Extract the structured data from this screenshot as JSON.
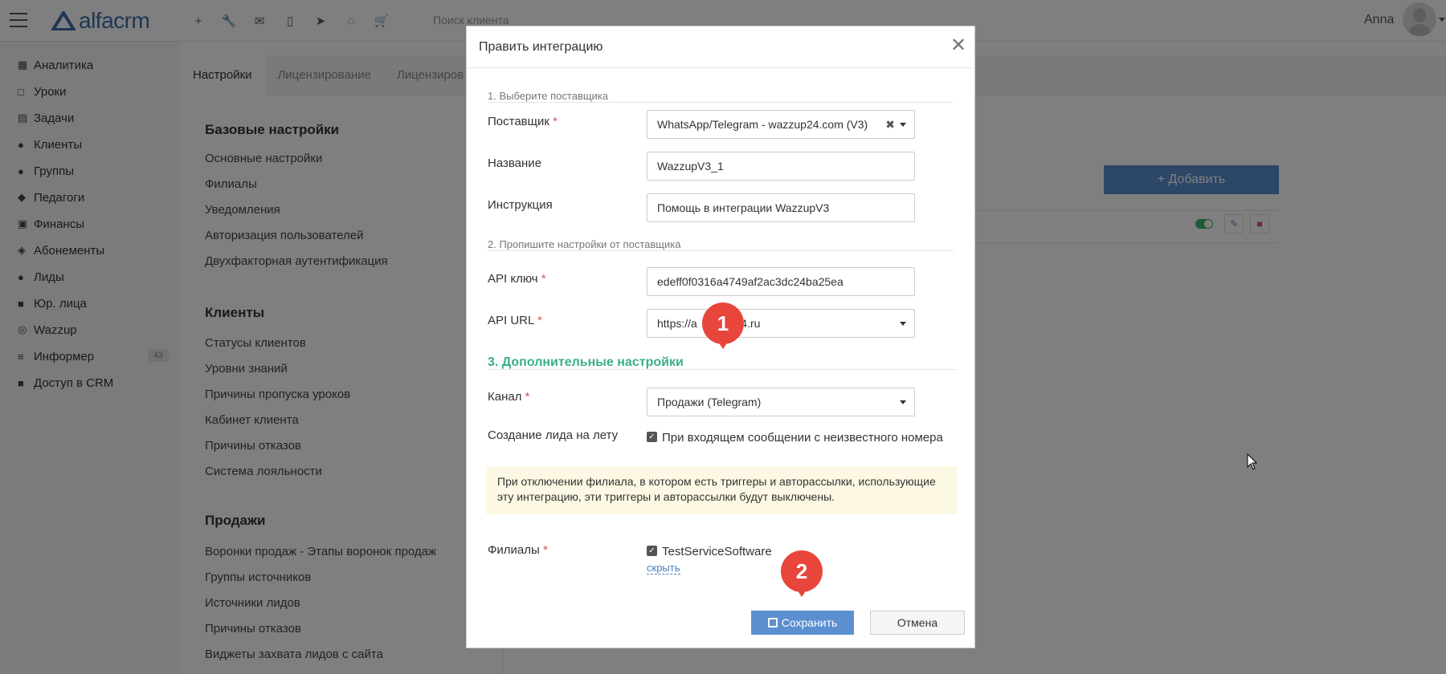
{
  "app": {
    "brand": "alfacrm",
    "search_placeholder": "Поиск клиента",
    "user_name": "Anna"
  },
  "sidebar": {
    "items": [
      {
        "label": "Аналитика",
        "icon": "map-icon"
      },
      {
        "label": "Уроки",
        "icon": "calendar-icon"
      },
      {
        "label": "Задачи",
        "icon": "clipboard-icon"
      },
      {
        "label": "Клиенты",
        "icon": "user-icon"
      },
      {
        "label": "Группы",
        "icon": "users-icon"
      },
      {
        "label": "Педагоги",
        "icon": "graduation-cap-icon"
      },
      {
        "label": "Финансы",
        "icon": "money-icon"
      },
      {
        "label": "Абонементы",
        "icon": "tag-icon"
      },
      {
        "label": "Лиды",
        "icon": "user-plus-icon"
      },
      {
        "label": "Юр. лица",
        "icon": "briefcase-icon"
      },
      {
        "label": "Wazzup",
        "icon": "whatsapp-icon"
      },
      {
        "label": "Информер",
        "icon": "database-icon",
        "badge": "43"
      },
      {
        "label": "Доступ в CRM",
        "icon": "lock-icon"
      }
    ]
  },
  "tabs": [
    "Настройки",
    "Лицензирование",
    "Лицензиров"
  ],
  "settings": {
    "base_title": "Базовые настройки",
    "base_links": [
      "Основные настройки",
      "Филиалы",
      "Уведомления",
      "Авторизация пользователей",
      "Двухфакторная аутентификация"
    ],
    "clients_title": "Клиенты",
    "clients_links": [
      "Статусы клиентов",
      "Уровни знаний",
      "Причины пропуска уроков",
      "Кабинет клиента",
      "Причины отказов",
      "Система лояльности"
    ],
    "sales_title": "Продажи",
    "sales_links": [
      "Воронки продаж - Этапы воронок продаж",
      "Группы источников",
      "Источники лидов",
      "Причины отказов",
      "Виджеты захвата лидов с сайта"
    ]
  },
  "add_button": "Добавить",
  "modal": {
    "title": "Править интеграцию",
    "section1": "1. Выберите поставщика",
    "provider_label": "Поставщик",
    "provider_value": "WhatsApp/Telegram - wazzup24.com (V3)",
    "name_label": "Название",
    "name_value": "WazzupV3_1",
    "instruction_label": "Инструкция",
    "instruction_value": "Помощь в интеграции WazzupV3",
    "section2": "2. Пропишите настройки от поставщика",
    "api_key_label": "API ключ",
    "api_key_value": "edeff0f0316a4749af2ac3dc24ba25ea",
    "api_url_label": "API URL",
    "api_url_value": "https://a          p24.ru",
    "section3": "3. Дополнительные настройки",
    "channel_label": "Канал",
    "channel_value": "Продажи (Telegram)",
    "lead_label": "Создание лида на лету",
    "lead_checkbox": "При входящем сообщении с неизвестного номера",
    "alert": "При отключении филиала, в котором есть триггеры и авторассылки, использующие эту интеграцию, эти триггеры и авторассылки будут выключены.",
    "branches_label": "Филиалы",
    "branch_checkbox": "TestServiceSoftware",
    "hide_link": "скрыть",
    "save": "Сохранить",
    "cancel": "Отмена"
  },
  "markers": [
    "1",
    "2"
  ],
  "colors": {
    "accent": "#5b8fd0",
    "section_green": "#3aae8a",
    "marker_red": "#e8453c"
  }
}
